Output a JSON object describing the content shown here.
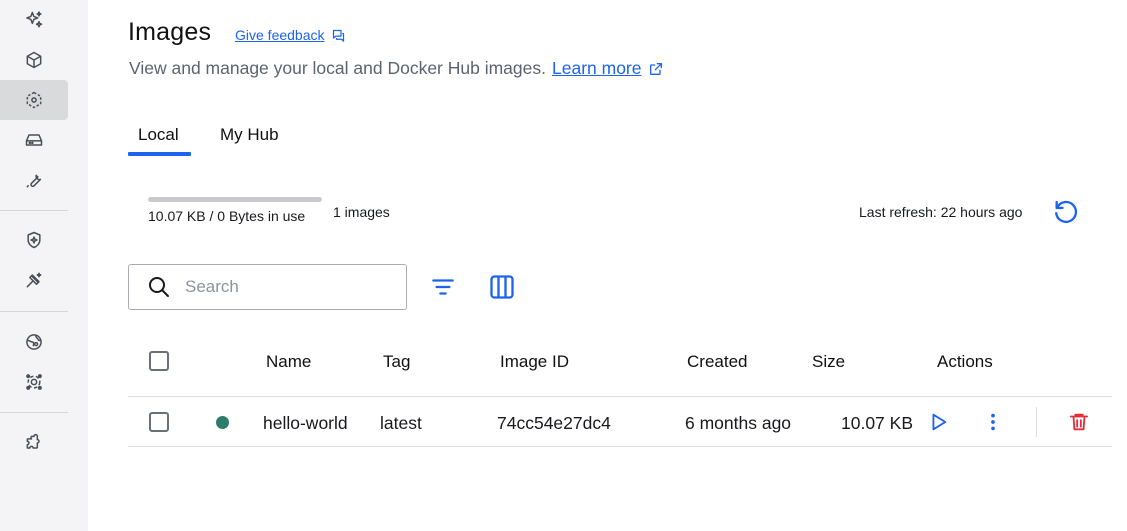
{
  "colors": {
    "accent": "#1d63ed",
    "danger": "#e02e3b",
    "status_running": "#2e7d6b",
    "icon_gray": "#4a4f57"
  },
  "sidebar": {
    "items": [
      {
        "icon": "ai-sparkle-icon",
        "active": false
      },
      {
        "icon": "containers-icon",
        "active": false
      },
      {
        "icon": "images-icon",
        "active": true
      },
      {
        "icon": "volumes-icon",
        "active": false
      },
      {
        "icon": "builds-icon",
        "active": false
      },
      {
        "icon": "scout-icon",
        "active": false
      },
      {
        "icon": "models-icon",
        "active": false
      },
      {
        "icon": "hub-globe-icon",
        "active": false
      },
      {
        "icon": "kubernetes-icon",
        "active": false
      },
      {
        "icon": "extensions-icon",
        "active": false
      }
    ]
  },
  "header": {
    "title": "Images",
    "feedback_label": "Give feedback",
    "subtitle": "View and manage your local and Docker Hub images.",
    "learn_more": "Learn more"
  },
  "tabs": [
    {
      "label": "Local",
      "active": true
    },
    {
      "label": "My Hub",
      "active": false
    }
  ],
  "usage": {
    "text": "10.07 KB / 0 Bytes in use",
    "fill_fraction": 0,
    "images_count": "1 images"
  },
  "refresh": {
    "label": "Last refresh: 22 hours ago"
  },
  "search": {
    "placeholder": "Search",
    "value": ""
  },
  "table": {
    "columns": [
      "Name",
      "Tag",
      "Image ID",
      "Created",
      "Size",
      "Actions"
    ],
    "rows": [
      {
        "status": "in-use",
        "name": "hello-world",
        "tag": "latest",
        "image_id": "74cc54e27dc4",
        "created": "6 months ago",
        "size": "10.07 KB"
      }
    ]
  }
}
